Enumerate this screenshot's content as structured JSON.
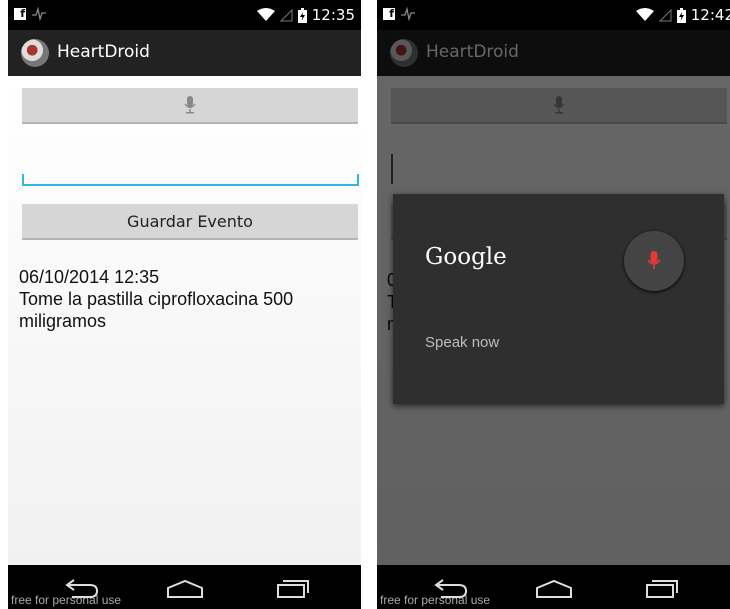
{
  "app": {
    "title": "HeartDroid"
  },
  "left": {
    "status_time": "12:35",
    "save_label": "Guardar Evento",
    "event_date": "06/10/2014 12:35",
    "event_text": "Tome la pastilla ciprofloxacina 500 miligramos"
  },
  "right": {
    "status_time": "12:42",
    "partial_event_lines": [
      "0",
      "T",
      "m"
    ],
    "voice_dialog": {
      "brand": "Google",
      "prompt": "Speak now"
    }
  },
  "watermark": "free for personal use",
  "colors": {
    "accent": "#33b5e5",
    "mic_red": "#e53935",
    "action_bar": "#222222"
  },
  "icons": [
    "facebook-icon",
    "pulse-icon",
    "wifi-icon",
    "battery-icon",
    "mic-icon",
    "back-icon",
    "home-icon",
    "recent-apps-icon"
  ]
}
